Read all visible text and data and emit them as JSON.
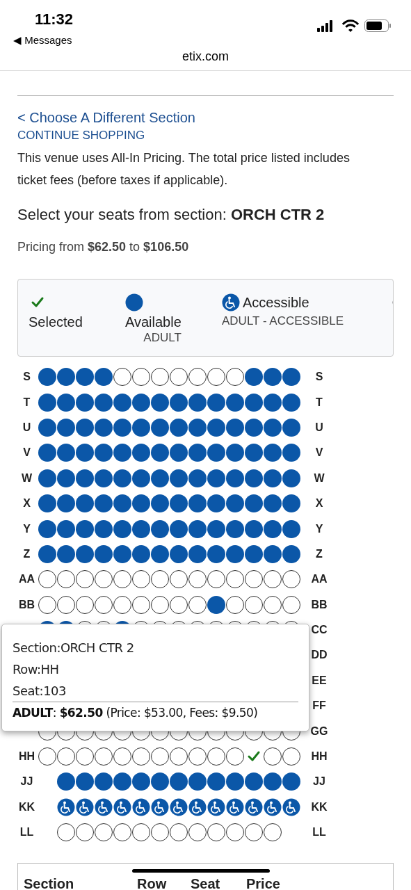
{
  "status_bar": {
    "time": "11:32",
    "back_label": "◀ Messages"
  },
  "browser": {
    "url": "etix.com"
  },
  "links": [
    {
      "label": "< Choose A Different Section",
      "kind": "large"
    },
    {
      "label": "CONTINUE SHOPPING",
      "kind": "small"
    }
  ],
  "notice": "This venue uses All-In Pricing. The total price listed includes ticket fees (before taxes if applicable).",
  "heading": "Select your seats from section: **ORCH CTR 2**",
  "pricing": "Pricing from **$62.50** to **$106.50**",
  "legend": [
    {
      "kind": "selected",
      "label": "Selected"
    },
    {
      "kind": "available",
      "label": "Available",
      "sublabel": "ADULT"
    },
    {
      "kind": "accessible",
      "label": "Accessible",
      "sublabel": "ADULT - ACCESSIBLE"
    }
  ],
  "seat_rows": [
    {
      "label_left": "S",
      "label_right": "S",
      "indented": false,
      "seats": [
        {
          "kind": "available"
        },
        {
          "kind": "available"
        },
        {
          "kind": "available"
        },
        {
          "kind": "available"
        },
        {
          "kind": "empty"
        },
        {
          "kind": "empty"
        },
        {
          "kind": "empty"
        },
        {
          "kind": "empty"
        },
        {
          "kind": "empty"
        },
        {
          "kind": "empty"
        },
        {
          "kind": "empty"
        },
        {
          "kind": "available"
        },
        {
          "kind": "available"
        },
        {
          "kind": "available"
        }
      ]
    },
    {
      "label_left": "T",
      "label_right": "T",
      "indented": false,
      "seats": [
        {
          "kind": "available"
        },
        {
          "kind": "available"
        },
        {
          "kind": "available"
        },
        {
          "kind": "available"
        },
        {
          "kind": "available"
        },
        {
          "kind": "available"
        },
        {
          "kind": "available"
        },
        {
          "kind": "available"
        },
        {
          "kind": "available"
        },
        {
          "kind": "available"
        },
        {
          "kind": "available"
        },
        {
          "kind": "available"
        },
        {
          "kind": "available"
        },
        {
          "kind": "available"
        }
      ]
    },
    {
      "label_left": "U",
      "label_right": "U",
      "indented": false,
      "seats": [
        {
          "kind": "available"
        },
        {
          "kind": "available"
        },
        {
          "kind": "available"
        },
        {
          "kind": "available"
        },
        {
          "kind": "available"
        },
        {
          "kind": "available"
        },
        {
          "kind": "available"
        },
        {
          "kind": "available"
        },
        {
          "kind": "available"
        },
        {
          "kind": "available"
        },
        {
          "kind": "available"
        },
        {
          "kind": "available"
        },
        {
          "kind": "available"
        },
        {
          "kind": "available"
        }
      ]
    },
    {
      "label_left": "V",
      "label_right": "V",
      "indented": false,
      "seats": [
        {
          "kind": "available"
        },
        {
          "kind": "available"
        },
        {
          "kind": "available"
        },
        {
          "kind": "available"
        },
        {
          "kind": "available"
        },
        {
          "kind": "available"
        },
        {
          "kind": "available"
        },
        {
          "kind": "available"
        },
        {
          "kind": "available"
        },
        {
          "kind": "available"
        },
        {
          "kind": "available"
        },
        {
          "kind": "available"
        },
        {
          "kind": "available"
        },
        {
          "kind": "available"
        }
      ]
    },
    {
      "label_left": "W",
      "label_right": "W",
      "indented": false,
      "seats": [
        {
          "kind": "available"
        },
        {
          "kind": "available"
        },
        {
          "kind": "available"
        },
        {
          "kind": "available"
        },
        {
          "kind": "available"
        },
        {
          "kind": "available"
        },
        {
          "kind": "available"
        },
        {
          "kind": "available"
        },
        {
          "kind": "available"
        },
        {
          "kind": "available"
        },
        {
          "kind": "available"
        },
        {
          "kind": "available"
        },
        {
          "kind": "available"
        },
        {
          "kind": "available"
        }
      ]
    },
    {
      "label_left": "X",
      "label_right": "X",
      "indented": false,
      "seats": [
        {
          "kind": "available"
        },
        {
          "kind": "available"
        },
        {
          "kind": "available"
        },
        {
          "kind": "available"
        },
        {
          "kind": "available"
        },
        {
          "kind": "available"
        },
        {
          "kind": "available"
        },
        {
          "kind": "available"
        },
        {
          "kind": "available"
        },
        {
          "kind": "available"
        },
        {
          "kind": "available"
        },
        {
          "kind": "available"
        },
        {
          "kind": "available"
        },
        {
          "kind": "available"
        }
      ]
    },
    {
      "label_left": "Y",
      "label_right": "Y",
      "indented": false,
      "seats": [
        {
          "kind": "available"
        },
        {
          "kind": "available"
        },
        {
          "kind": "available"
        },
        {
          "kind": "available"
        },
        {
          "kind": "available"
        },
        {
          "kind": "available"
        },
        {
          "kind": "available"
        },
        {
          "kind": "available"
        },
        {
          "kind": "available"
        },
        {
          "kind": "available"
        },
        {
          "kind": "available"
        },
        {
          "kind": "available"
        },
        {
          "kind": "available"
        },
        {
          "kind": "available"
        }
      ]
    },
    {
      "label_left": "Z",
      "label_right": "Z",
      "indented": false,
      "seats": [
        {
          "kind": "available"
        },
        {
          "kind": "available"
        },
        {
          "kind": "available"
        },
        {
          "kind": "available"
        },
        {
          "kind": "available"
        },
        {
          "kind": "available"
        },
        {
          "kind": "available"
        },
        {
          "kind": "available"
        },
        {
          "kind": "available"
        },
        {
          "kind": "available"
        },
        {
          "kind": "available"
        },
        {
          "kind": "available"
        },
        {
          "kind": "available"
        },
        {
          "kind": "available"
        }
      ]
    },
    {
      "label_left": "AA",
      "label_right": "AA",
      "indented": false,
      "seats": [
        {
          "kind": "empty"
        },
        {
          "kind": "empty"
        },
        {
          "kind": "empty"
        },
        {
          "kind": "empty"
        },
        {
          "kind": "empty"
        },
        {
          "kind": "empty"
        },
        {
          "kind": "empty"
        },
        {
          "kind": "empty"
        },
        {
          "kind": "empty"
        },
        {
          "kind": "empty"
        },
        {
          "kind": "empty"
        },
        {
          "kind": "empty"
        },
        {
          "kind": "empty"
        },
        {
          "kind": "empty"
        }
      ]
    },
    {
      "label_left": "BB",
      "label_right": "BB",
      "indented": false,
      "seats": [
        {
          "kind": "empty"
        },
        {
          "kind": "empty"
        },
        {
          "kind": "empty"
        },
        {
          "kind": "empty"
        },
        {
          "kind": "empty"
        },
        {
          "kind": "empty"
        },
        {
          "kind": "empty"
        },
        {
          "kind": "empty"
        },
        {
          "kind": "empty"
        },
        {
          "kind": "available"
        },
        {
          "kind": "empty"
        },
        {
          "kind": "empty"
        },
        {
          "kind": "empty"
        },
        {
          "kind": "empty"
        }
      ]
    },
    {
      "label_right": "CC",
      "indented": false,
      "seats": [
        {
          "kind": "available"
        },
        {
          "kind": "available"
        },
        {
          "kind": "empty"
        },
        {
          "kind": "empty"
        },
        {
          "kind": "available"
        },
        {
          "kind": "empty"
        },
        {
          "kind": "empty"
        },
        {
          "kind": "empty"
        },
        {
          "kind": "empty"
        },
        {
          "kind": "empty"
        },
        {
          "kind": "empty"
        },
        {
          "kind": "empty"
        },
        {
          "kind": "empty"
        },
        {
          "kind": "empty"
        }
      ]
    },
    {
      "label_right": "DD"
    },
    {
      "label_right": "EE"
    },
    {
      "label_right": "FF"
    },
    {
      "label_right": "GG",
      "indented": false,
      "seats": [
        {
          "kind": "empty"
        },
        {
          "kind": "empty"
        },
        {
          "kind": "empty"
        },
        {
          "kind": "empty"
        },
        {
          "kind": "empty"
        },
        {
          "kind": "empty"
        },
        {
          "kind": "empty"
        },
        {
          "kind": "empty"
        },
        {
          "kind": "empty"
        },
        {
          "kind": "empty"
        },
        {
          "kind": "empty"
        },
        {
          "kind": "empty"
        },
        {
          "kind": "empty"
        },
        {
          "kind": "empty"
        }
      ]
    },
    {
      "label_left": "HH",
      "label_right": "HH",
      "indented": false,
      "seats": [
        {
          "kind": "empty"
        },
        {
          "kind": "empty"
        },
        {
          "kind": "empty"
        },
        {
          "kind": "empty"
        },
        {
          "kind": "empty"
        },
        {
          "kind": "empty"
        },
        {
          "kind": "empty"
        },
        {
          "kind": "empty"
        },
        {
          "kind": "empty"
        },
        {
          "kind": "empty"
        },
        {
          "kind": "empty"
        },
        {
          "kind": "selected"
        },
        {
          "kind": "empty"
        },
        {
          "kind": "empty"
        }
      ]
    },
    {
      "label_left": "JJ",
      "label_right": "JJ",
      "indented": true,
      "seats": [
        {
          "kind": "available"
        },
        {
          "kind": "available"
        },
        {
          "kind": "available"
        },
        {
          "kind": "available"
        },
        {
          "kind": "available"
        },
        {
          "kind": "available"
        },
        {
          "kind": "available"
        },
        {
          "kind": "available"
        },
        {
          "kind": "available"
        },
        {
          "kind": "available"
        },
        {
          "kind": "available"
        },
        {
          "kind": "available"
        },
        {
          "kind": "available"
        }
      ]
    },
    {
      "label_left": "KK",
      "label_right": "KK",
      "indented": true,
      "seats": [
        {
          "kind": "accessible"
        },
        {
          "kind": "accessible"
        },
        {
          "kind": "accessible"
        },
        {
          "kind": "accessible"
        },
        {
          "kind": "accessible"
        },
        {
          "kind": "accessible"
        },
        {
          "kind": "accessible"
        },
        {
          "kind": "accessible"
        },
        {
          "kind": "accessible"
        },
        {
          "kind": "accessible"
        },
        {
          "kind": "accessible"
        },
        {
          "kind": "accessible"
        },
        {
          "kind": "accessible"
        }
      ]
    },
    {
      "label_left": "LL",
      "label_right": "LL",
      "indented": true,
      "seats": [
        {
          "kind": "empty"
        },
        {
          "kind": "empty"
        },
        {
          "kind": "empty"
        },
        {
          "kind": "empty"
        },
        {
          "kind": "empty"
        },
        {
          "kind": "empty"
        },
        {
          "kind": "empty"
        },
        {
          "kind": "empty"
        },
        {
          "kind": "empty"
        },
        {
          "kind": "empty"
        },
        {
          "kind": "empty"
        },
        {
          "kind": "empty"
        }
      ]
    }
  ],
  "tooltip": {
    "lines": [
      "Section:ORCH CTR 2",
      "Row:HH",
      "Seat:103"
    ],
    "price_line": "**ADULT**: **$62.50** (Price: $53.00, Fees: $9.50)"
  },
  "summary_table": {
    "columns": [
      "Section",
      "Row",
      "Seat",
      "Price"
    ]
  }
}
